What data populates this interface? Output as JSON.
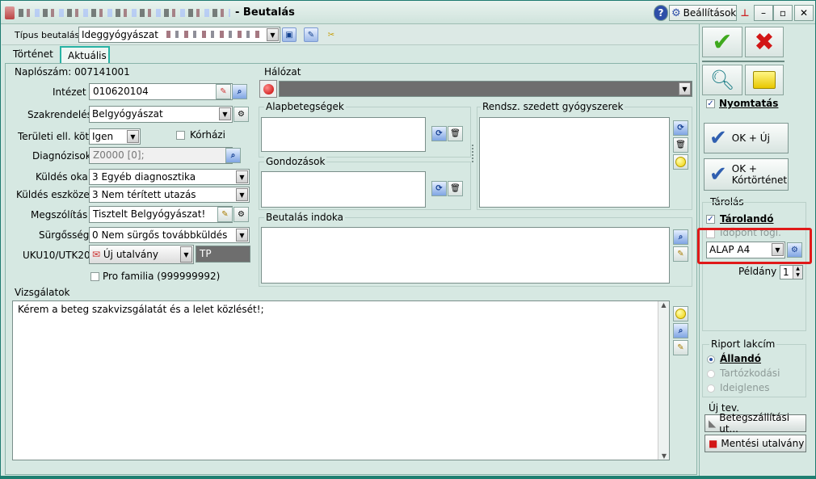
{
  "window": {
    "title_suffix": "- Beutalás",
    "settings_label": "Beállítások",
    "help_label": "?",
    "minimize_label": "–",
    "maximize_label": "▫",
    "close_label": "✕"
  },
  "toolbar": {
    "tipus_label": "Típus beutalás:",
    "tipus_value": "Ideggyógyászat"
  },
  "tabs": [
    {
      "label": "Történet"
    },
    {
      "label": "Aktuális"
    }
  ],
  "form": {
    "naplo_label": "Naplószám: 007141001",
    "intezet_label": "Intézet",
    "intezet_value": "010620104",
    "szakrendeles_label": "Szakrendelés",
    "szakrendeles_value": "Belgyógyászat",
    "teruleti_label": "Területi ell. köt",
    "teruleti_value": "Igen",
    "korhazi_label": "Kórházi",
    "diagnozis_label": "Diagnózisok",
    "diagnozis_value": "Z0000 [0];",
    "kuldes_oka_label": "Küldés oka",
    "kuldes_oka_value": "3 Egyéb diagnosztika",
    "kuldes_eszkoze_label": "Küldés eszköze",
    "kuldes_eszkoze_value": "3 Nem térített utazás",
    "megszolitas_label": "Megszólítás",
    "megszolitas_value": "Tisztelt Belgyógyászat!",
    "surgosseg_label": "Sürgősség",
    "surgosseg_value": "0 Nem sürgős továbbküldés",
    "uku_label": "UKU10/UTK20",
    "uku_value": "Új utalvány",
    "tp_value": "TP",
    "pro_familia_label": "Pro familia (999999992)",
    "vizsgalatok_label": "Vizsgálatok",
    "vizsgalatok_text": "Kérem a beteg szakvizsgálatát és a lelet közlését!;"
  },
  "right": {
    "halozat_label": "Hálózat",
    "alap_label": "Alapbetegségek",
    "rendsz_label": "Rendsz. szedett gyógyszerek",
    "gondozas_label": "Gondozások",
    "beutalas_indoka_label": "Beutalás indoka"
  },
  "sidebar": {
    "nyomtatas_label": "Nyomtatás",
    "ok_uj_label": "OK + Új",
    "ok_kortortenet_line1": "OK +",
    "ok_kortortenet_line2": "Kórtörténet",
    "tarolas_label": "Tárolás",
    "tarolando_label": "Tárolandó",
    "idopont_label": "Időpont fogl.",
    "alap_a4_value": "ALAP A4",
    "peldany_label": "Példány",
    "peldany_value": "1",
    "riport_label": "Riport lakcím",
    "allando_label": "Állandó",
    "tartozkodasi_label": "Tartózkodási",
    "ideiglenes_label": "Ideiglenes",
    "uj_tev_label": "Új tev.",
    "betegszallitasi_label": "Betegszállítási ut...",
    "mentesi_label": "Mentési utalvány"
  },
  "colors": {
    "accent": "#28b2a4",
    "window_bg": "#d6e8e2",
    "highlight_red": "#e01919"
  }
}
